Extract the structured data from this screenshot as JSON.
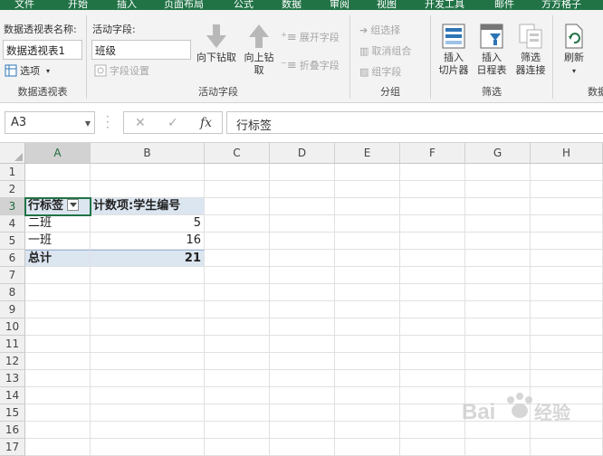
{
  "ribbon_tabs": [
    "文件",
    "开始",
    "插入",
    "页面布局",
    "公式",
    "数据",
    "审阅",
    "视图",
    "开发工具",
    "邮件",
    "方方格子"
  ],
  "ribbon": {
    "pivot_group": {
      "name_label": "数据透视表名称:",
      "name_value": "数据透视表1",
      "options_label": "选项",
      "group_label": "数据透视表"
    },
    "active_field_group": {
      "label": "活动字段:",
      "value": "班级",
      "settings_label": "字段设置",
      "drill_down": "向下钻取",
      "drill_up_1": "向上钻",
      "drill_up_2": "取",
      "expand": "展开字段",
      "collapse": "折叠字段",
      "group_label": "活动字段"
    },
    "group_group": {
      "group_selection": "组选择",
      "ungroup": "取消组合",
      "group_field": "组字段",
      "group_label": "分组"
    },
    "filter_group": {
      "slicer_1": "插入",
      "slicer_2": "切片器",
      "timeline_1": "插入",
      "timeline_2": "日程表",
      "filter_conn_1": "筛选",
      "filter_conn_2": "器连接",
      "group_label": "筛选"
    },
    "data_group": {
      "refresh": "刷新",
      "group_label": "数据"
    }
  },
  "formula_bar": {
    "name_box": "A3",
    "formula": "行标签"
  },
  "columns": [
    "A",
    "B",
    "C",
    "D",
    "E",
    "F",
    "G",
    "H"
  ],
  "rows": [
    "1",
    "2",
    "3",
    "4",
    "5",
    "6",
    "7",
    "8",
    "9",
    "10",
    "11",
    "12",
    "13",
    "14",
    "15",
    "16",
    "17"
  ],
  "pivot": {
    "header_a": "行标签",
    "header_b": "计数项:学生编号",
    "row1_label": "二班",
    "row1_value": "5",
    "row2_label": "一班",
    "row2_value": "16",
    "total_label": "总计",
    "total_value": "21"
  },
  "watermark": "Baidu 经验"
}
